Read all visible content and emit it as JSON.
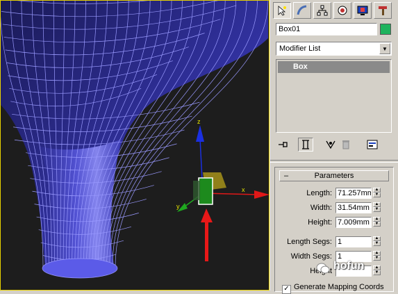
{
  "viewport": {
    "axis_labels": {
      "x": "x",
      "y": "y",
      "z": "z"
    },
    "colors": {
      "mesh": "#6f6ff7",
      "background": "#1d1d1d",
      "frame": "#e8d200"
    }
  },
  "panel": {
    "tabs": [
      {
        "icon": "create-arrow-icon"
      },
      {
        "icon": "modify-arc-icon"
      },
      {
        "icon": "hierarchy-icon"
      },
      {
        "icon": "motion-icon"
      },
      {
        "icon": "display-icon"
      },
      {
        "icon": "utilities-hammer-icon"
      }
    ],
    "object_name": "Box01",
    "object_color": "#1fb35d",
    "modifier_list": "Modifier List",
    "stack_items": [
      "Box"
    ],
    "rollout_title": "Parameters",
    "params": [
      {
        "label": "Length:",
        "value": "71.257mm"
      },
      {
        "label": "Width:",
        "value": "31.54mm"
      },
      {
        "label": "Height:",
        "value": "7.009mm"
      },
      {
        "label": "Length Segs:",
        "value": "1"
      },
      {
        "label": "Width Segs:",
        "value": "1"
      },
      {
        "label": "Height",
        "value": ""
      }
    ],
    "checkbox_label": "Generate Mapping Coords",
    "checkbox_checked": "✓"
  },
  "watermark": "hofun"
}
